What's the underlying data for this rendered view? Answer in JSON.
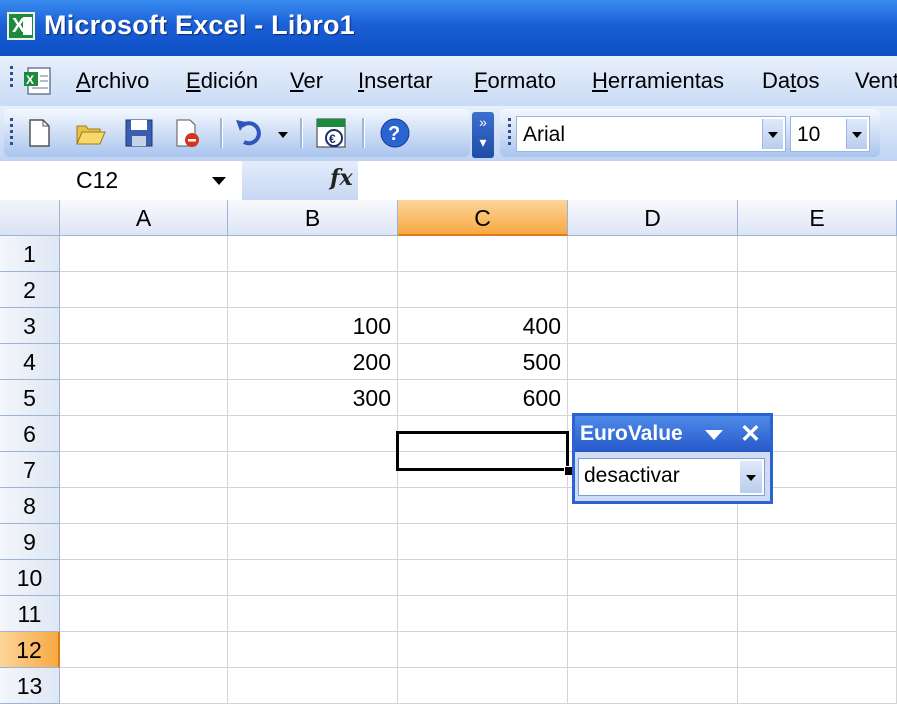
{
  "window": {
    "title": "Microsoft Excel - Libro1"
  },
  "menu": {
    "items": [
      {
        "label": "Archivo",
        "key": "A"
      },
      {
        "label": "Edición",
        "key": "E"
      },
      {
        "label": "Ver",
        "key": "V"
      },
      {
        "label": "Insertar",
        "key": "I"
      },
      {
        "label": "Formato",
        "key": "F"
      },
      {
        "label": "Herramientas",
        "key": "H"
      },
      {
        "label": "Datos",
        "key": "t"
      },
      {
        "label": "Vent"
      }
    ]
  },
  "toolbar": {
    "font_name": "Arial",
    "font_size": "10",
    "buttons": [
      "new-icon",
      "open-icon",
      "save-icon",
      "permission-icon",
      "undo-icon",
      "undo-dropdown-icon",
      "euro-conversion-icon",
      "help-icon",
      "toolbar-options-icon"
    ]
  },
  "formula_bar": {
    "name_box": "C12",
    "fx_label": "fx",
    "formula": ""
  },
  "sheet": {
    "columns": [
      "A",
      "B",
      "C",
      "D",
      "E"
    ],
    "selected_column": "C",
    "rows": [
      "1",
      "2",
      "3",
      "4",
      "5",
      "6",
      "7",
      "8",
      "9",
      "10",
      "11",
      "12",
      "13"
    ],
    "selected_row": "12",
    "active_cell": "C12",
    "cells": {
      "B3": "100",
      "C3": "400",
      "B4": "200",
      "C4": "500",
      "B5": "300",
      "C5": "600"
    }
  },
  "eurovalue": {
    "title": "EuroValue",
    "mode": "desactivar"
  },
  "colors": {
    "titlebar": "#1a5fd6",
    "selection_header": "#f7a941",
    "excel_green": "#1e8a3c"
  }
}
